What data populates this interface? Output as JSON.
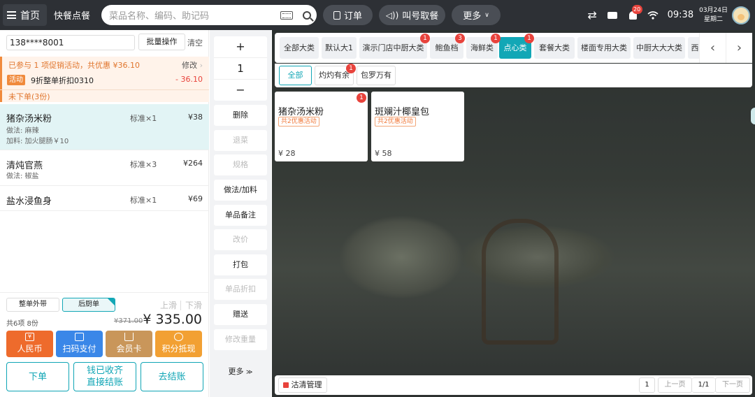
{
  "topbar": {
    "home_label": "首页",
    "mode_label": "快餐点餐",
    "search_placeholder": "菜品名称、编码、助记码",
    "orders_label": "订单",
    "call_label": "叫号取餐",
    "more_label": "更多",
    "notif_count": "20",
    "time": "09:38",
    "date": "03月24日",
    "weekday": "星期二"
  },
  "order": {
    "phone": "138****8001",
    "batch_label": "批量操作",
    "clear_label": "清空",
    "promo_prefix": "已参与",
    "promo_count": "1",
    "promo_mid": "项促销活动，共优惠",
    "promo_amount": "¥36.10",
    "modify_label": "修改",
    "activity_tag": "活动",
    "activity_name": "9折整单折扣0310",
    "activity_amount": "- 36.10",
    "pending_label": "未下单(3份)",
    "items": [
      {
        "name": "猪杂汤米粉",
        "spec": "标准×1",
        "price": "¥38",
        "sub1": "做法:   麻辣",
        "sub2": "加料:   加火腿肠￥10"
      },
      {
        "name": "清炖官燕",
        "spec": "标准×3",
        "price": "¥264",
        "sub1": "做法:   椒盐",
        "sub2": ""
      },
      {
        "name": "盐水浸鱼身",
        "spec": "标准×1",
        "price": "¥69",
        "sub1": "",
        "sub2": ""
      }
    ],
    "takeout_label": "整单外带",
    "kitchen_label": "后厨单",
    "slide_up": "上滑",
    "slide_down": "下滑",
    "summary": "共6项 8份",
    "original_total": "¥371.00",
    "total": "¥ 335.00",
    "pay_methods": [
      {
        "label": "人民币",
        "color": "#ee6b2c"
      },
      {
        "label": "扫码支付",
        "color": "#3a87e8"
      },
      {
        "label": "会员卡",
        "color": "#c9965a"
      },
      {
        "label": "积分抵现",
        "color": "#f2a033"
      }
    ],
    "actions": {
      "place_order": "下单",
      "collected_line1": "钱已收齐",
      "collected_line2": "直接结账",
      "checkout": "去结账"
    }
  },
  "middle": {
    "plus": "+",
    "qty": "1",
    "minus": "−",
    "buttons": [
      {
        "label": "删除",
        "enabled": true
      },
      {
        "label": "退菜",
        "enabled": false
      },
      {
        "label": "规格",
        "enabled": false
      },
      {
        "label": "做法/加料",
        "enabled": true
      },
      {
        "label": "单品备注",
        "enabled": true
      },
      {
        "label": "改价",
        "enabled": false
      },
      {
        "label": "打包",
        "enabled": true
      },
      {
        "label": "单品折扣",
        "enabled": false
      },
      {
        "label": "赠送",
        "enabled": true
      },
      {
        "label": "修改重量",
        "enabled": false
      }
    ],
    "more_label": "更多"
  },
  "menu": {
    "categories": [
      {
        "label": "全部大类",
        "badge": ""
      },
      {
        "label": "默认大1",
        "badge": ""
      },
      {
        "label": "演示门店中厨大类",
        "badge": "1"
      },
      {
        "label": "鲍鱼档",
        "badge": "3"
      },
      {
        "label": "海鲜类",
        "badge": "1"
      },
      {
        "label": "点心类",
        "badge": "1"
      },
      {
        "label": "套餐大类",
        "badge": ""
      },
      {
        "label": "楼面专用大类",
        "badge": ""
      },
      {
        "label": "中厨大大大类",
        "badge": ""
      },
      {
        "label": "西",
        "badge": ""
      }
    ],
    "subcategories": [
      {
        "label": "全部",
        "badge": ""
      },
      {
        "label": "灼灼有余",
        "badge": "1"
      },
      {
        "label": "包罗万有",
        "badge": ""
      }
    ],
    "dishes": [
      {
        "name": "猪杂汤米粉",
        "tag": "共2优惠活动",
        "price": "¥ 28",
        "badge": "1"
      },
      {
        "name": "斑斓汁椰皇包",
        "tag": "共2优惠活动",
        "price": "¥ 58",
        "badge": ""
      }
    ],
    "clear_label": "沽清管理",
    "page_current": "1",
    "prev_label": "上一页",
    "page_info": "1/1",
    "next_label": "下一页"
  }
}
